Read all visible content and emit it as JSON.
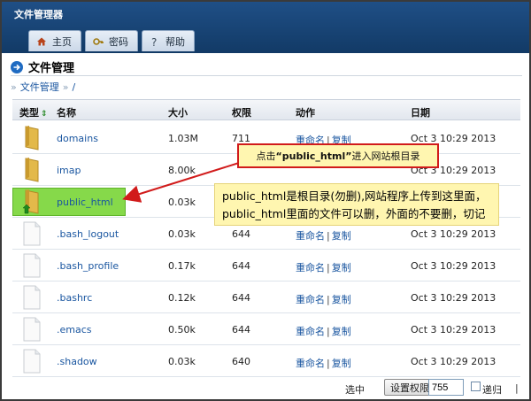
{
  "app": {
    "title": "文件管理器"
  },
  "nav": {
    "tabs": [
      {
        "label": "主页",
        "icon": "home-icon"
      },
      {
        "label": "密码",
        "icon": "key-icon"
      },
      {
        "label": "帮助",
        "icon": "question-icon"
      }
    ]
  },
  "page": {
    "title": "文件管理"
  },
  "breadcrumb": {
    "prefix": "»",
    "root": "文件管理",
    "sep": "»",
    "path": "/"
  },
  "table": {
    "columns": {
      "type": "类型",
      "name": "名称",
      "size": "大小",
      "perm": "权限",
      "action": "动作",
      "date": "日期"
    },
    "rows": [
      {
        "kind": "folder",
        "name": "domains",
        "size": "1.03M",
        "perm": "711",
        "rename": "重命名",
        "copy": "复制",
        "date": "Oct 3 10:29 2013"
      },
      {
        "kind": "folder",
        "name": "imap",
        "size": "8.00k",
        "perm": "",
        "rename": "",
        "copy": "",
        "date": "Oct 3 10:29 2013"
      },
      {
        "kind": "folder-link",
        "name": "public_html",
        "size": "0.03k",
        "perm": "",
        "rename": "",
        "copy": "",
        "date": ""
      },
      {
        "kind": "file",
        "name": ".bash_logout",
        "size": "0.03k",
        "perm": "644",
        "rename": "重命名",
        "copy": "复制",
        "date": "Oct 3 10:29 2013"
      },
      {
        "kind": "file",
        "name": ".bash_profile",
        "size": "0.17k",
        "perm": "644",
        "rename": "重命名",
        "copy": "复制",
        "date": "Oct 3 10:29 2013"
      },
      {
        "kind": "file",
        "name": ".bashrc",
        "size": "0.12k",
        "perm": "644",
        "rename": "重命名",
        "copy": "复制",
        "date": "Oct 3 10:29 2013"
      },
      {
        "kind": "file",
        "name": ".emacs",
        "size": "0.50k",
        "perm": "644",
        "rename": "重命名",
        "copy": "复制",
        "date": "Oct 3 10:29 2013"
      },
      {
        "kind": "file",
        "name": ".shadow",
        "size": "0.03k",
        "perm": "640",
        "rename": "重命名",
        "copy": "复制",
        "date": "Oct 3 10:29 2013"
      }
    ]
  },
  "footer": {
    "selected_label": "选中",
    "set_perm_button": "设置权限",
    "perm_value": "755",
    "recursive_label": "递归",
    "sep": "|"
  },
  "callouts": {
    "click_hint": {
      "pre": "点击",
      "quote": "“public_html”",
      "post": "进入网站根目录"
    },
    "note_line1": "public_html是根目录(勿删),网站程序上传到这里面，",
    "note_line2": "public_html里面的文件可以删，外面的不要删，切记"
  },
  "colors": {
    "header": "#1f4f86",
    "link": "#1a56a0",
    "highlight": "#86d94a",
    "callout_bg": "#fff6b0",
    "arrow": "#d11b1b"
  }
}
